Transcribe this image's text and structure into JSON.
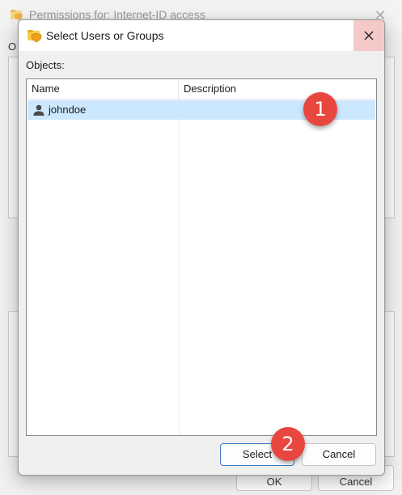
{
  "parent_window": {
    "title": "Permissions for: Internet-ID access",
    "fragment_label": "O",
    "ok_label": "OK",
    "cancel_label": "Cancel"
  },
  "dialog": {
    "title": "Select Users or Groups",
    "objects_label": "Objects:",
    "columns": [
      "Name",
      "Description"
    ],
    "rows": [
      {
        "name": "johndoe",
        "description": "",
        "icon": "user-icon",
        "selected": true
      }
    ],
    "select_label": "Select",
    "cancel_label": "Cancel"
  },
  "annotations": [
    "1",
    "2"
  ],
  "colors": {
    "selection": "#cce8ff",
    "close_hover": "#f4c9c7",
    "badge": "#e8473f",
    "default_button_border": "#3c78c3"
  }
}
